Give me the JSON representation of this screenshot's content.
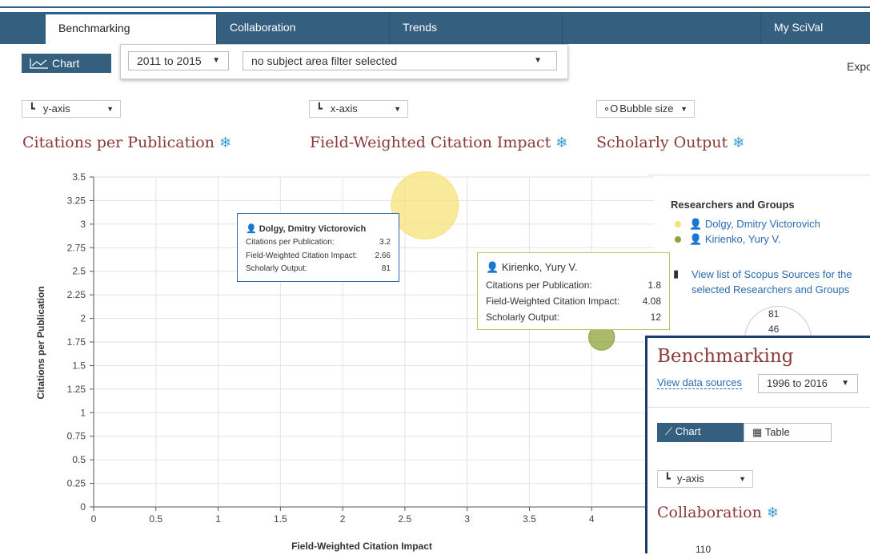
{
  "nav": {
    "tabs": [
      {
        "label": "Benchmarking"
      },
      {
        "label": "Collaboration"
      },
      {
        "label": "Trends"
      },
      {
        "label": ""
      },
      {
        "label": "My SciVal"
      }
    ]
  },
  "toolbar": {
    "chart_label": "Chart",
    "year_range": "2011 to 2015",
    "subject_filter": "no subject area filter selected",
    "export_label": "Expo"
  },
  "axes_controls": {
    "y_axis": "y-axis",
    "x_axis": "x-axis",
    "bubble": "Bubble size"
  },
  "metrics": {
    "y_metric": "Citations per Publication",
    "x_metric": "Field-Weighted Citation Impact",
    "bubble_metric": "Scholarly Output"
  },
  "chart_data": {
    "type": "scatter",
    "xlabel": "Field-Weighted Citation Impact",
    "ylabel": "Citations per Publication",
    "xlim": [
      0,
      4.5
    ],
    "ylim": [
      0,
      3.5
    ],
    "x_ticks": [
      "0",
      "0.5",
      "1",
      "1.5",
      "2",
      "2.5",
      "3",
      "3.5",
      "4"
    ],
    "y_ticks": [
      "0",
      "0.25",
      "0.5",
      "0.75",
      "1",
      "1.25",
      "1.5",
      "1.75",
      "2",
      "2.25",
      "2.5",
      "2.75",
      "3",
      "3.25",
      "3.5"
    ],
    "grid": true,
    "series": [
      {
        "name": "Dolgy, Dmitry Victorovich",
        "x": 2.66,
        "y": 3.2,
        "size": 81,
        "color": "#f7e27a"
      },
      {
        "name": "Kirienko, Yury V.",
        "x": 4.08,
        "y": 1.8,
        "size": 12,
        "color": "#8ea33a"
      }
    ]
  },
  "tooltips": [
    {
      "name": "Dolgy, Dmitry Victorovich",
      "rows": [
        {
          "label": "Citations per Publication:",
          "value": "3.2"
        },
        {
          "label": "Field-Weighted Citation Impact:",
          "value": "2.66"
        },
        {
          "label": "Scholarly Output:",
          "value": "81"
        }
      ]
    },
    {
      "name": "Kirienko, Yury V.",
      "rows": [
        {
          "label": "Citations per Publication:",
          "value": "1.8"
        },
        {
          "label": "Field-Weighted Citation Impact:",
          "value": "4.08"
        },
        {
          "label": "Scholarly Output:",
          "value": "12"
        }
      ]
    }
  ],
  "legend": {
    "title": "Researchers and Groups",
    "items": [
      {
        "label": "Dolgy, Dmitry Victorovich",
        "color": "#f7e27a"
      },
      {
        "label": "Kirienko, Yury V.",
        "color": "#8ea33a"
      }
    ],
    "scopus_link_1": "View list of Scopus Sources for the",
    "scopus_link_2": "selected Researchers and Groups",
    "size_legend": [
      "81",
      "46"
    ]
  },
  "overlay": {
    "title": "Benchmarking",
    "data_sources": "View data sources",
    "year_range": "1996 to 2016",
    "chart_label": "Chart",
    "table_label": "Table",
    "y_axis": "y-axis",
    "metric": "Collaboration",
    "tick": "110"
  },
  "colors": {
    "nav": "#345f7f",
    "metric_title": "#8b3a3a",
    "accent": "#3a9bd6"
  }
}
